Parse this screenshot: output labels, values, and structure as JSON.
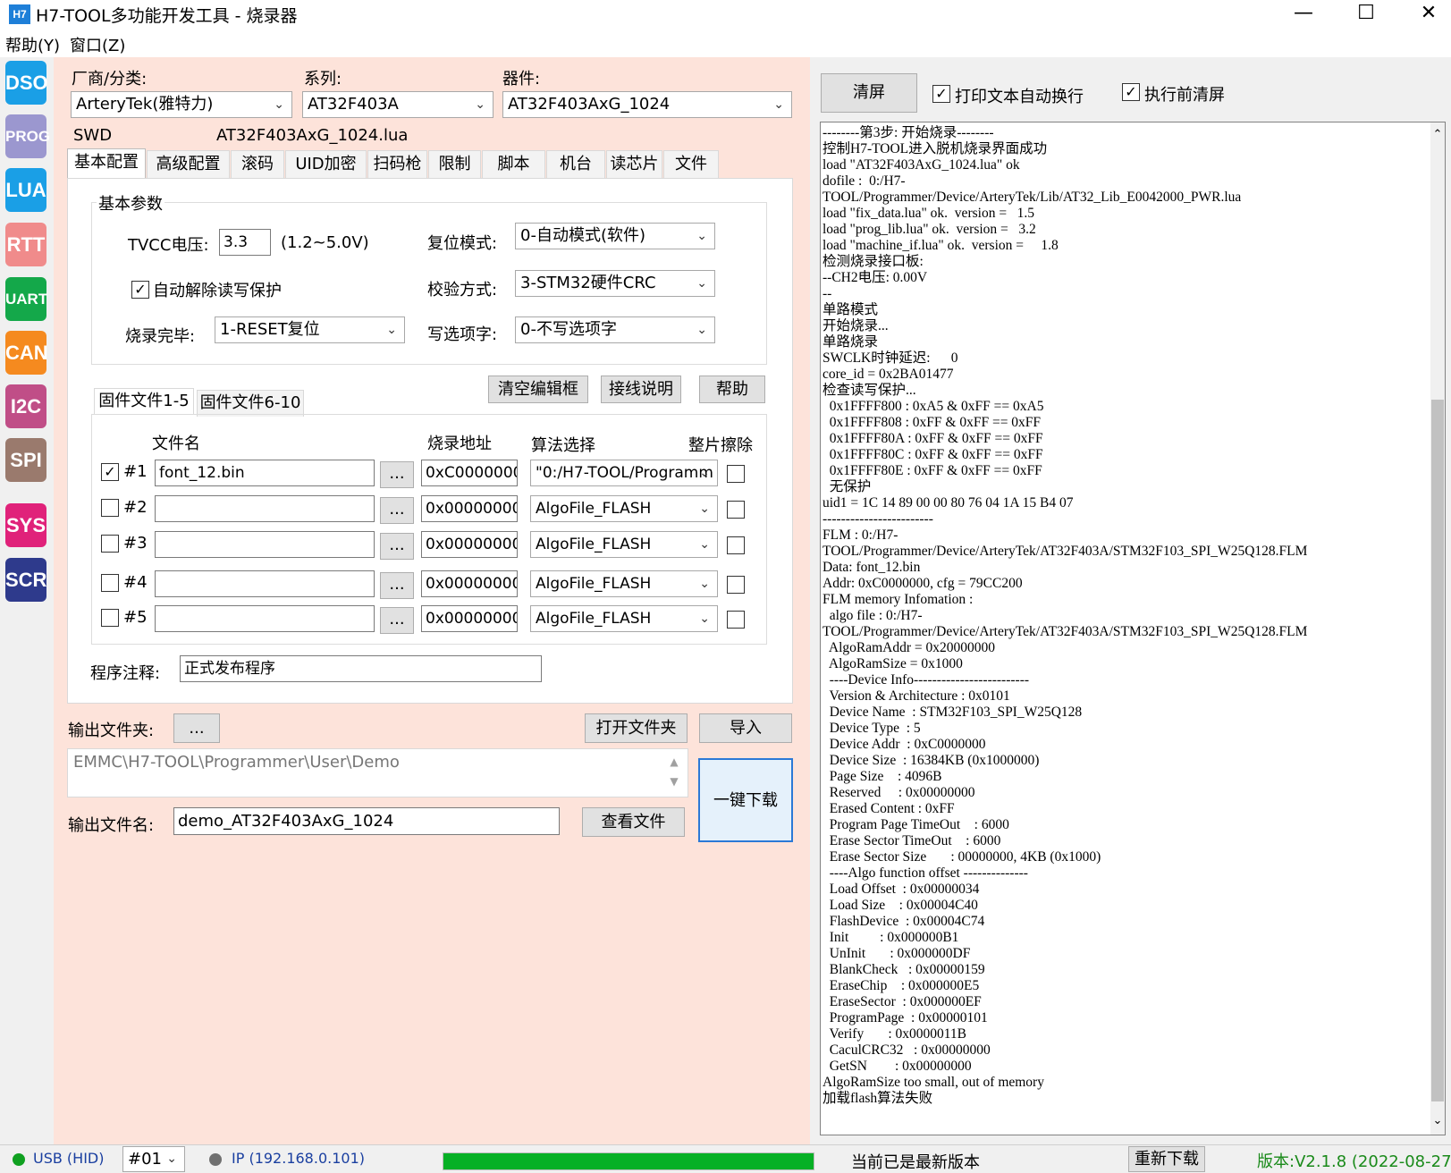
{
  "window": {
    "app_icon": "H7",
    "title": "H7-TOOL多功能开发工具 - 烧录器",
    "minimize": "—",
    "maximize": "☐",
    "close": "✕"
  },
  "menu": [
    "帮助(Y)",
    "窗口(Z)"
  ],
  "nav": [
    {
      "label": "DSO",
      "color": "#1a9fe6"
    },
    {
      "label": "PROG",
      "color": "#9b97cf"
    },
    {
      "label": "LUA",
      "color": "#1a9fe6"
    },
    {
      "label": "RTT",
      "color": "#f08b8b"
    },
    {
      "label": "UART",
      "color": "#14a84a"
    },
    {
      "label": "CAN",
      "color": "#f58a1f"
    },
    {
      "label": "I2C",
      "color": "#c04e87"
    },
    {
      "label": "SPI",
      "color": "#9a7a6d"
    },
    {
      "label": "SYS",
      "color": "#e0227a"
    },
    {
      "label": "SCR",
      "color": "#2e3a8c"
    }
  ],
  "device": {
    "vendor_label": "厂商/分类:",
    "series_label": "系列:",
    "device_label": "器件:",
    "vendor": "ArteryTek(雅特力)",
    "series": "AT32F403A",
    "device": "AT32F403AxG_1024",
    "interface": "SWD",
    "lua_file": "AT32F403AxG_1024.lua"
  },
  "tabs": [
    "基本配置",
    "高级配置",
    "滚码",
    "UID加密",
    "扫码枪",
    "限制",
    "脚本",
    "机台",
    "读芯片",
    "文件"
  ],
  "basic": {
    "group_title": "基本参数",
    "tvcc_label": "TVCC电压:",
    "tvcc_value": "3.3",
    "tvcc_range": "(1.2~5.0V)",
    "reset_label": "复位模式:",
    "reset_value": "0-自动模式(软件)",
    "auto_unlock_label": "自动解除读写保护",
    "verify_label": "校验方式:",
    "verify_value": "3-STM32硬件CRC",
    "done_label": "烧录完毕:",
    "done_value": "1-RESET复位",
    "write_opt_label": "写选项字:",
    "write_opt_value": "0-不写选项字"
  },
  "buttons": {
    "clear_edit": "清空编辑框",
    "wiring": "接线说明",
    "help": "帮助",
    "browse": "..."
  },
  "fw_tabs": [
    "固件文件1-5",
    "固件文件6-10"
  ],
  "fw_headers": {
    "name": "文件名",
    "addr": "烧录地址",
    "algo": "算法选择",
    "erase": "整片擦除"
  },
  "firmware": [
    {
      "idx": "#1",
      "checked": true,
      "file": "font_12.bin",
      "addr": "0xC0000000",
      "algo": "\"0:/H7-TOOL/Programm"
    },
    {
      "idx": "#2",
      "checked": false,
      "file": "",
      "addr": "0x00000000",
      "algo": "AlgoFile_FLASH"
    },
    {
      "idx": "#3",
      "checked": false,
      "file": "",
      "addr": "0x00000000",
      "algo": "AlgoFile_FLASH"
    },
    {
      "idx": "#4",
      "checked": false,
      "file": "",
      "addr": "0x00000000",
      "algo": "AlgoFile_FLASH"
    },
    {
      "idx": "#5",
      "checked": false,
      "file": "",
      "addr": "0x00000000",
      "algo": "AlgoFile_FLASH"
    }
  ],
  "note": {
    "label": "程序注释:",
    "value": "正式发布程序"
  },
  "output": {
    "folder_label": "输出文件夹:",
    "open_folder": "打开文件夹",
    "import": "导入",
    "path": "EMMC\\H7-TOOL\\Programmer\\User\\Demo",
    "name_label": "输出文件名:",
    "name": "demo_AT32F403AxG_1024",
    "view_file": "查看文件",
    "download": "一键下载"
  },
  "right": {
    "clear": "清屏",
    "wrap_label": "打印文本自动换行",
    "clear_before_label": "执行前清屏"
  },
  "log": [
    "--------第3步: 开始烧录--------",
    "控制H7-TOOL进入脱机烧录界面成功",
    "load \"AT32F403AxG_1024.lua\" ok",
    "dofile :  0:/H7-",
    "TOOL/Programmer/Device/ArteryTek/Lib/AT32_Lib_E0042000_PWR.lua",
    "load \"fix_data.lua\" ok.  version =   1.5",
    "load \"prog_lib.lua\" ok.  version =   3.2",
    "load \"machine_if.lua\" ok.  version =     1.8",
    "检测烧录接口板:",
    "--CH2电压: 0.00V",
    "--",
    "单路模式",
    "开始烧录...",
    "单路烧录",
    "SWCLK时钟延迟:      0",
    "core_id = 0x2BA01477",
    "检查读写保护...",
    "  0x1FFFF800 : 0xA5 & 0xFF == 0xA5",
    "  0x1FFFF808 : 0xFF & 0xFF == 0xFF",
    "  0x1FFFF80A : 0xFF & 0xFF == 0xFF",
    "  0x1FFFF80C : 0xFF & 0xFF == 0xFF",
    "  0x1FFFF80E : 0xFF & 0xFF == 0xFF",
    "  无保护",
    "uid1 = 1C 14 89 00 00 80 76 04 1A 15 B4 07",
    "------------------------",
    "FLM : 0:/H7-",
    "TOOL/Programmer/Device/ArteryTek/AT32F403A/STM32F103_SPI_W25Q128.FLM",
    "Data: font_12.bin",
    "Addr: 0xC0000000, cfg = 79CC200",
    "FLM memory Infomation :",
    "  algo file : 0:/H7-",
    "TOOL/Programmer/Device/ArteryTek/AT32F403A/STM32F103_SPI_W25Q128.FLM",
    "  AlgoRamAddr = 0x20000000",
    "  AlgoRamSize = 0x1000",
    "  ----Device Info-------------------------",
    "  Version & Architecture : 0x0101",
    "  Device Name  : STM32F103_SPI_W25Q128",
    "  Device Type  : 5",
    "  Device Addr  : 0xC0000000",
    "  Device Size  : 16384KB (0x1000000)",
    "  Page Size    : 4096B",
    "  Reserved     : 0x00000000",
    "  Erased Content : 0xFF",
    "  Program Page TimeOut    : 6000",
    "  Erase Sector TimeOut    : 6000",
    "  Erase Sector Size       : 00000000, 4KB (0x1000)",
    "  ----Algo function offset --------------",
    "  Load Offset  : 0x00000034",
    "  Load Size    : 0x00004C40",
    "  FlashDevice  : 0x00004C74",
    "  Init         : 0x000000B1",
    "  UnInit       : 0x000000DF",
    "  BlankCheck   : 0x00000159",
    "  EraseChip    : 0x000000E5",
    "  EraseSector  : 0x000000EF",
    "  ProgramPage  : 0x00000101",
    "  Verify       : 0x0000011B",
    "  CaculCRC32   : 0x00000000",
    "  GetSN        : 0x00000000",
    "AlgoRamSize too small, out of memory",
    "加载flash算法失败"
  ],
  "status": {
    "usb": "USB (HID)",
    "usb_color": "#10a020",
    "port": "#01",
    "ip": "IP (192.168.0.101)",
    "ip_color": "#707070",
    "progress": 1.0,
    "update_msg": "当前已是最新版本",
    "redownload": "重新下载",
    "version": "版本:V2.1.8 (2022-08-27)",
    "version_color": "#1a8a1a"
  }
}
